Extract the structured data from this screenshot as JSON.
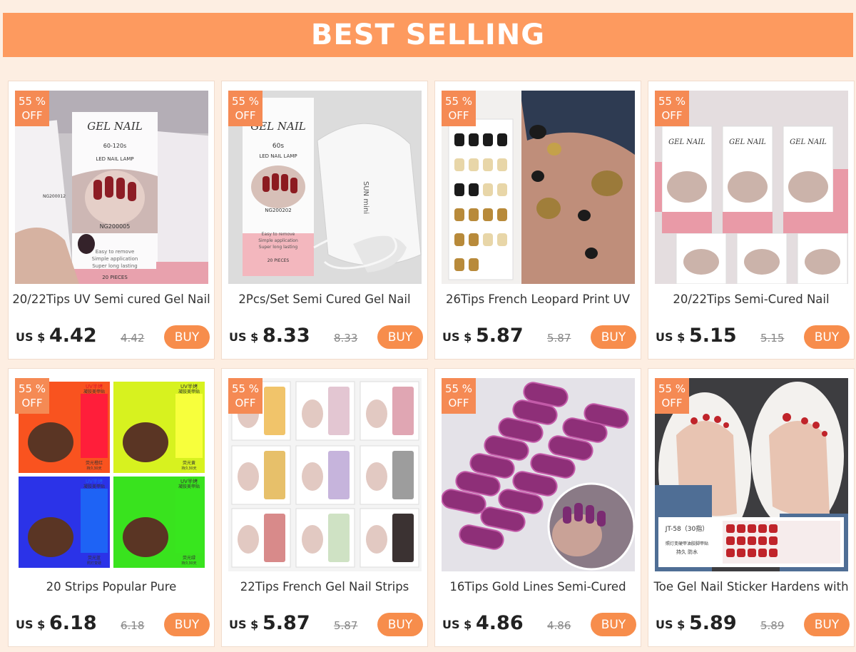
{
  "banner": {
    "title": "BEST SELLING"
  },
  "products": [
    {
      "discount": "55 %\nOFF",
      "title": "20/22Tips UV Semi cured Gel Nail",
      "currency": "US $",
      "price": "4.42",
      "old_price": "4.42",
      "buy_label": "BUY"
    },
    {
      "discount": "55 %\nOFF",
      "title": "2Pcs/Set Semi Cured Gel Nail",
      "currency": "US $",
      "price": "8.33",
      "old_price": "8.33",
      "buy_label": "BUY"
    },
    {
      "discount": "55 %\nOFF",
      "title": "26Tips French Leopard Print UV",
      "currency": "US $",
      "price": "5.87",
      "old_price": "5.87",
      "buy_label": "BUY"
    },
    {
      "discount": "55 %\nOFF",
      "title": "20/22Tips Semi-Cured Nail",
      "currency": "US $",
      "price": "5.15",
      "old_price": "5.15",
      "buy_label": "BUY"
    },
    {
      "discount": "55 %\nOFF",
      "title": "20 Strips Popular Pure",
      "currency": "US $",
      "price": "6.18",
      "old_price": "6.18",
      "buy_label": "BUY"
    },
    {
      "discount": "55 %\nOFF",
      "title": "22Tips French Gel Nail Strips",
      "currency": "US $",
      "price": "5.87",
      "old_price": "5.87",
      "buy_label": "BUY"
    },
    {
      "discount": "55 %\nOFF",
      "title": "16Tips Gold Lines Semi-Cured",
      "currency": "US $",
      "price": "4.86",
      "old_price": "4.86",
      "buy_label": "BUY"
    },
    {
      "discount": "55 %\nOFF",
      "title": "Toe Gel Nail Sticker Hardens with",
      "currency": "US $",
      "price": "5.89",
      "old_price": "5.89",
      "buy_label": "BUY"
    }
  ],
  "photo_text": {
    "p1": {
      "brand": "GEL NAIL",
      "sub": "60-120s",
      "lamp": "LED NAIL LAMP",
      "code": "NG200005",
      "code2": "NG200012",
      "l1": "Easy to remove",
      "l2": "Simple application",
      "l3": "Super long lasting",
      "count": "20 PIECES"
    },
    "p2": {
      "brand": "GEL NAIL",
      "sub": "60s",
      "lamp": "LED NAIL LAMP",
      "code": "NG200202",
      "l1": "Easy to remove",
      "l2": "Simple application",
      "l3": "Super long lasting",
      "count": "20 PIECES",
      "device": "SUN mini"
    },
    "p5": {
      "t1": "UV半烤",
      "t2": "凝胶美甲贴",
      "c1": "荧光橙红",
      "c2": "荧光黄",
      "c3": "荧光蓝",
      "c4": "荧光绿",
      "s1": "照灯变硬",
      "s2": "持久30天"
    },
    "p8": {
      "code": "JT-58（30指）",
      "l1": "照灯变硬甲油胶脚甲贴",
      "l2": "持久 防水"
    }
  },
  "colors": {
    "accent": "#fd9a5f",
    "badge": "#f58a54",
    "buy_button": "#f78d4c",
    "background": "#fdeee2"
  },
  "icons": [
    "discount-badge",
    "product-photo"
  ]
}
